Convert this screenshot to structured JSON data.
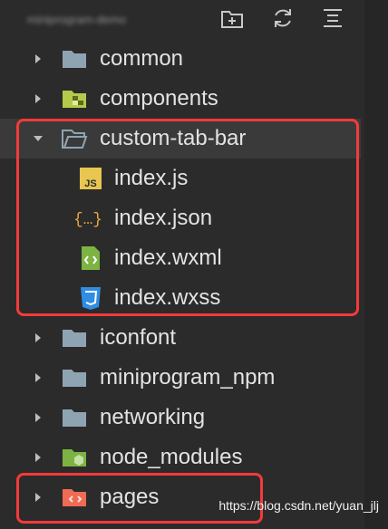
{
  "header": {
    "project_name": "miniprogram-demo"
  },
  "tree": [
    {
      "label": "common",
      "icon": "folder-icon",
      "expanded": false
    },
    {
      "label": "components",
      "icon": "components-folder-icon",
      "expanded": false
    },
    {
      "label": "custom-tab-bar",
      "icon": "folder-open-icon",
      "expanded": true
    },
    {
      "label": "index.js",
      "icon": "js-file-icon"
    },
    {
      "label": "index.json",
      "icon": "json-file-icon"
    },
    {
      "label": "index.wxml",
      "icon": "wxml-file-icon"
    },
    {
      "label": "index.wxss",
      "icon": "wxss-file-icon"
    },
    {
      "label": "iconfont",
      "icon": "folder-icon",
      "expanded": false
    },
    {
      "label": "miniprogram_npm",
      "icon": "folder-icon",
      "expanded": false
    },
    {
      "label": "networking",
      "icon": "folder-icon",
      "expanded": false
    },
    {
      "label": "node_modules",
      "icon": "node-modules-folder-icon",
      "expanded": false
    },
    {
      "label": "pages",
      "icon": "pages-folder-icon",
      "expanded": false
    }
  ],
  "watermark": "https://blog.csdn.net/yuan_jlj",
  "colors": {
    "background": "#2b2b2b",
    "highlight": "#f43a3a",
    "folder": "#8fa4b2"
  }
}
